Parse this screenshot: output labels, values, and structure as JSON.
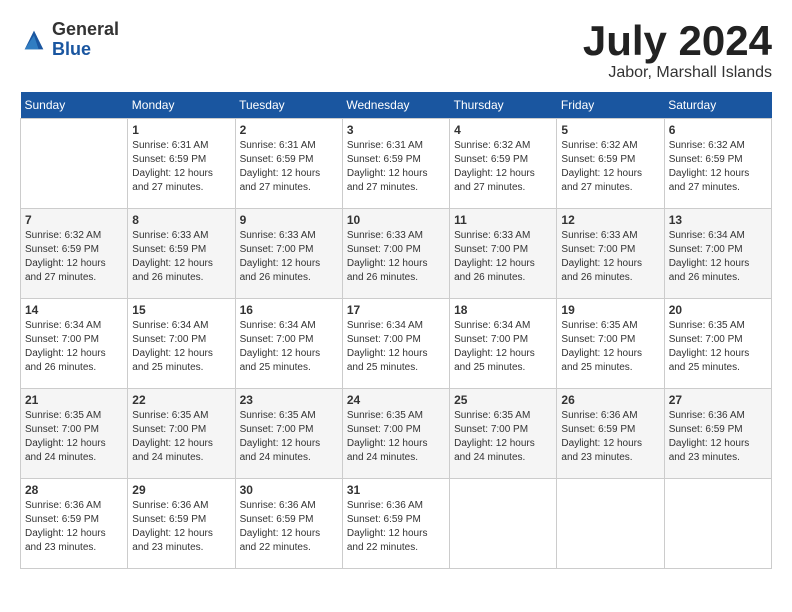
{
  "logo": {
    "general": "General",
    "blue": "Blue"
  },
  "title": {
    "month_year": "July 2024",
    "location": "Jabor, Marshall Islands"
  },
  "days_of_week": [
    "Sunday",
    "Monday",
    "Tuesday",
    "Wednesday",
    "Thursday",
    "Friday",
    "Saturday"
  ],
  "weeks": [
    [
      {
        "day": "",
        "sunrise": "",
        "sunset": "",
        "daylight": "",
        "empty": true
      },
      {
        "day": "1",
        "sunrise": "Sunrise: 6:31 AM",
        "sunset": "Sunset: 6:59 PM",
        "daylight": "Daylight: 12 hours and 27 minutes."
      },
      {
        "day": "2",
        "sunrise": "Sunrise: 6:31 AM",
        "sunset": "Sunset: 6:59 PM",
        "daylight": "Daylight: 12 hours and 27 minutes."
      },
      {
        "day": "3",
        "sunrise": "Sunrise: 6:31 AM",
        "sunset": "Sunset: 6:59 PM",
        "daylight": "Daylight: 12 hours and 27 minutes."
      },
      {
        "day": "4",
        "sunrise": "Sunrise: 6:32 AM",
        "sunset": "Sunset: 6:59 PM",
        "daylight": "Daylight: 12 hours and 27 minutes."
      },
      {
        "day": "5",
        "sunrise": "Sunrise: 6:32 AM",
        "sunset": "Sunset: 6:59 PM",
        "daylight": "Daylight: 12 hours and 27 minutes."
      },
      {
        "day": "6",
        "sunrise": "Sunrise: 6:32 AM",
        "sunset": "Sunset: 6:59 PM",
        "daylight": "Daylight: 12 hours and 27 minutes."
      }
    ],
    [
      {
        "day": "7",
        "sunrise": "Sunrise: 6:32 AM",
        "sunset": "Sunset: 6:59 PM",
        "daylight": "Daylight: 12 hours and 27 minutes."
      },
      {
        "day": "8",
        "sunrise": "Sunrise: 6:33 AM",
        "sunset": "Sunset: 6:59 PM",
        "daylight": "Daylight: 12 hours and 26 minutes."
      },
      {
        "day": "9",
        "sunrise": "Sunrise: 6:33 AM",
        "sunset": "Sunset: 7:00 PM",
        "daylight": "Daylight: 12 hours and 26 minutes."
      },
      {
        "day": "10",
        "sunrise": "Sunrise: 6:33 AM",
        "sunset": "Sunset: 7:00 PM",
        "daylight": "Daylight: 12 hours and 26 minutes."
      },
      {
        "day": "11",
        "sunrise": "Sunrise: 6:33 AM",
        "sunset": "Sunset: 7:00 PM",
        "daylight": "Daylight: 12 hours and 26 minutes."
      },
      {
        "day": "12",
        "sunrise": "Sunrise: 6:33 AM",
        "sunset": "Sunset: 7:00 PM",
        "daylight": "Daylight: 12 hours and 26 minutes."
      },
      {
        "day": "13",
        "sunrise": "Sunrise: 6:34 AM",
        "sunset": "Sunset: 7:00 PM",
        "daylight": "Daylight: 12 hours and 26 minutes."
      }
    ],
    [
      {
        "day": "14",
        "sunrise": "Sunrise: 6:34 AM",
        "sunset": "Sunset: 7:00 PM",
        "daylight": "Daylight: 12 hours and 26 minutes."
      },
      {
        "day": "15",
        "sunrise": "Sunrise: 6:34 AM",
        "sunset": "Sunset: 7:00 PM",
        "daylight": "Daylight: 12 hours and 25 minutes."
      },
      {
        "day": "16",
        "sunrise": "Sunrise: 6:34 AM",
        "sunset": "Sunset: 7:00 PM",
        "daylight": "Daylight: 12 hours and 25 minutes."
      },
      {
        "day": "17",
        "sunrise": "Sunrise: 6:34 AM",
        "sunset": "Sunset: 7:00 PM",
        "daylight": "Daylight: 12 hours and 25 minutes."
      },
      {
        "day": "18",
        "sunrise": "Sunrise: 6:34 AM",
        "sunset": "Sunset: 7:00 PM",
        "daylight": "Daylight: 12 hours and 25 minutes."
      },
      {
        "day": "19",
        "sunrise": "Sunrise: 6:35 AM",
        "sunset": "Sunset: 7:00 PM",
        "daylight": "Daylight: 12 hours and 25 minutes."
      },
      {
        "day": "20",
        "sunrise": "Sunrise: 6:35 AM",
        "sunset": "Sunset: 7:00 PM",
        "daylight": "Daylight: 12 hours and 25 minutes."
      }
    ],
    [
      {
        "day": "21",
        "sunrise": "Sunrise: 6:35 AM",
        "sunset": "Sunset: 7:00 PM",
        "daylight": "Daylight: 12 hours and 24 minutes."
      },
      {
        "day": "22",
        "sunrise": "Sunrise: 6:35 AM",
        "sunset": "Sunset: 7:00 PM",
        "daylight": "Daylight: 12 hours and 24 minutes."
      },
      {
        "day": "23",
        "sunrise": "Sunrise: 6:35 AM",
        "sunset": "Sunset: 7:00 PM",
        "daylight": "Daylight: 12 hours and 24 minutes."
      },
      {
        "day": "24",
        "sunrise": "Sunrise: 6:35 AM",
        "sunset": "Sunset: 7:00 PM",
        "daylight": "Daylight: 12 hours and 24 minutes."
      },
      {
        "day": "25",
        "sunrise": "Sunrise: 6:35 AM",
        "sunset": "Sunset: 7:00 PM",
        "daylight": "Daylight: 12 hours and 24 minutes."
      },
      {
        "day": "26",
        "sunrise": "Sunrise: 6:36 AM",
        "sunset": "Sunset: 6:59 PM",
        "daylight": "Daylight: 12 hours and 23 minutes."
      },
      {
        "day": "27",
        "sunrise": "Sunrise: 6:36 AM",
        "sunset": "Sunset: 6:59 PM",
        "daylight": "Daylight: 12 hours and 23 minutes."
      }
    ],
    [
      {
        "day": "28",
        "sunrise": "Sunrise: 6:36 AM",
        "sunset": "Sunset: 6:59 PM",
        "daylight": "Daylight: 12 hours and 23 minutes."
      },
      {
        "day": "29",
        "sunrise": "Sunrise: 6:36 AM",
        "sunset": "Sunset: 6:59 PM",
        "daylight": "Daylight: 12 hours and 23 minutes."
      },
      {
        "day": "30",
        "sunrise": "Sunrise: 6:36 AM",
        "sunset": "Sunset: 6:59 PM",
        "daylight": "Daylight: 12 hours and 22 minutes."
      },
      {
        "day": "31",
        "sunrise": "Sunrise: 6:36 AM",
        "sunset": "Sunset: 6:59 PM",
        "daylight": "Daylight: 12 hours and 22 minutes."
      },
      {
        "day": "",
        "sunrise": "",
        "sunset": "",
        "daylight": "",
        "empty": true
      },
      {
        "day": "",
        "sunrise": "",
        "sunset": "",
        "daylight": "",
        "empty": true
      },
      {
        "day": "",
        "sunrise": "",
        "sunset": "",
        "daylight": "",
        "empty": true
      }
    ]
  ]
}
